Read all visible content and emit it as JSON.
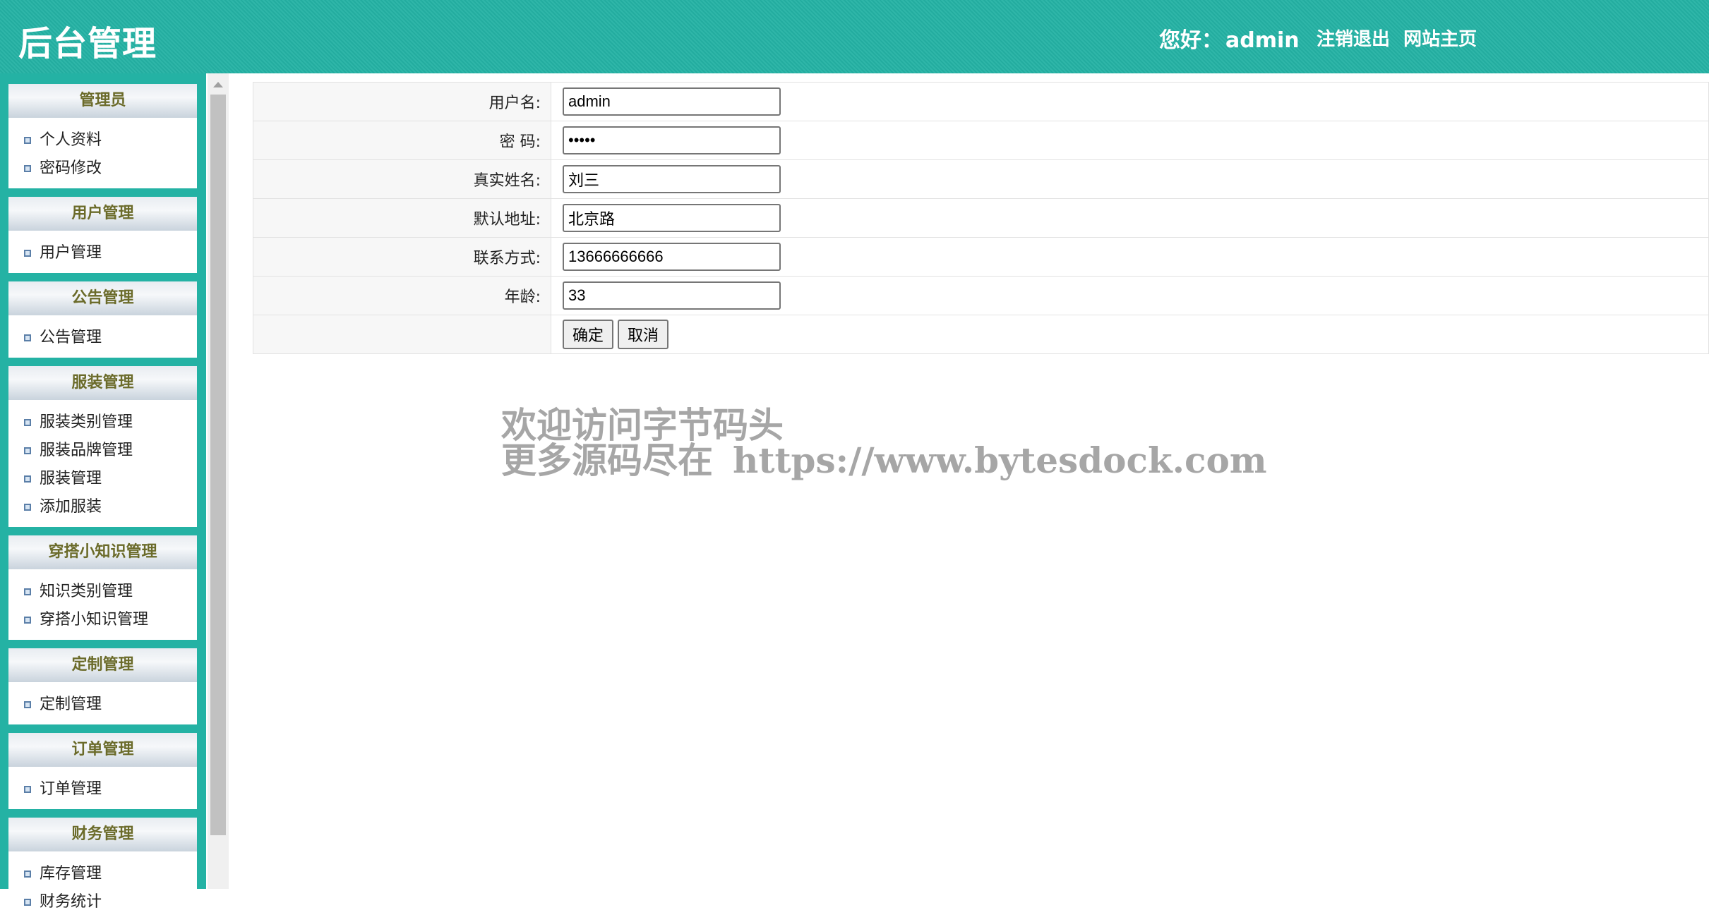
{
  "header": {
    "site_title": "后台管理",
    "greeting_label": "您好：",
    "username": "admin",
    "logout_label": "注销退出",
    "home_label": "网站主页",
    "bg_color": "#24b2a4"
  },
  "sidebar": {
    "groups": [
      {
        "title": "管理员",
        "items": [
          "个人资料",
          "密码修改"
        ]
      },
      {
        "title": "用户管理",
        "items": [
          "用户管理"
        ]
      },
      {
        "title": "公告管理",
        "items": [
          "公告管理"
        ]
      },
      {
        "title": "服装管理",
        "items": [
          "服装类别管理",
          "服装品牌管理",
          "服装管理",
          "添加服装"
        ]
      },
      {
        "title": "穿搭小知识管理",
        "items": [
          "知识类别管理",
          "穿搭小知识管理"
        ]
      },
      {
        "title": "定制管理",
        "items": [
          "定制管理"
        ]
      },
      {
        "title": "订单管理",
        "items": [
          "订单管理"
        ]
      },
      {
        "title": "财务管理",
        "items": [
          "库存管理",
          "财务统计"
        ]
      }
    ]
  },
  "form": {
    "fields": [
      {
        "label": "用户名:",
        "value": "admin",
        "type": "text"
      },
      {
        "label": "密 码:",
        "value": "•••••",
        "type": "password"
      },
      {
        "label": "真实姓名:",
        "value": "刘三",
        "type": "text"
      },
      {
        "label": "默认地址:",
        "value": "北京路",
        "type": "text"
      },
      {
        "label": "联系方式:",
        "value": "13666666666",
        "type": "text"
      },
      {
        "label": "年龄:",
        "value": "33",
        "type": "text"
      }
    ],
    "confirm_label": "确定",
    "cancel_label": "取消"
  },
  "watermark": {
    "line1": "欢迎访问字节码头",
    "line2_prefix": "更多源码尽在",
    "line2_url": "https://www.bytesdock.com"
  }
}
